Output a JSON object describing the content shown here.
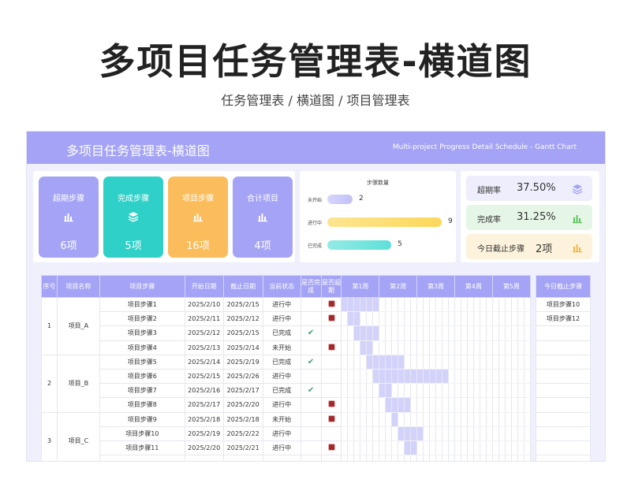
{
  "page": {
    "title": "多项目任务管理表-横道图",
    "subtitle": "任务管理表 / 横道图 / 项目管理表"
  },
  "banner": {
    "title": "多项目任务管理表-横道图",
    "subtitle_en": "Multi-project Progress Detail Schedule - Gantt Chart"
  },
  "kpis": [
    {
      "label": "超期步骤",
      "value": "6项",
      "color": "#a4a3f5",
      "icon": "bar-chart-icon"
    },
    {
      "label": "完成步骤",
      "value": "5项",
      "color": "#2ed0c7",
      "icon": "layers-icon"
    },
    {
      "label": "项目步骤",
      "value": "16项",
      "color": "#fbbd5b",
      "icon": "bar-chart-icon"
    },
    {
      "label": "合计项目",
      "value": "4项",
      "color": "#a4a3f5",
      "icon": "bar-chart-icon"
    }
  ],
  "step_chart": {
    "title": "步骤数量",
    "max": 9,
    "rows": [
      {
        "label": "未开始",
        "value": 2,
        "color": "#c2c1f9"
      },
      {
        "label": "进行中",
        "value": 9,
        "color": "#fcd85a"
      },
      {
        "label": "已完成",
        "value": 5,
        "color": "#5ee0d8"
      }
    ]
  },
  "rates": [
    {
      "label": "超期率",
      "value": "37.50%",
      "bg": "#eeeefc",
      "icon": "layers-icon",
      "icon_color": "#a4a3f5"
    },
    {
      "label": "完成率",
      "value": "31.25%",
      "bg": "#e6f6e6",
      "icon": "bar-chart-icon",
      "icon_color": "#5cc05c"
    },
    {
      "label": "今日截止步骤",
      "value": "2项",
      "bg": "#fdf3dc",
      "icon": "bar-chart-icon",
      "icon_color": "#f3b64a"
    }
  ],
  "table": {
    "headers": [
      "序号",
      "项目名称",
      "项目步骤",
      "开始日期",
      "截止日期",
      "当前状态",
      "是否完成",
      "是否超期"
    ],
    "weeks": [
      "第1周",
      "第2周",
      "第3周",
      "第4周",
      "第5周"
    ],
    "projects": [
      {
        "no": "1",
        "name": "项目_A",
        "steps": [
          {
            "step": "项目步骤1",
            "start": "2025/2/10",
            "end": "2025/2/15",
            "status": "进行中",
            "done": false,
            "overdue": true,
            "bar_from": 0,
            "bar_to": 5
          },
          {
            "step": "项目步骤2",
            "start": "2025/2/11",
            "end": "2025/2/12",
            "status": "进行中",
            "done": false,
            "overdue": true,
            "bar_from": 1,
            "bar_to": 2
          },
          {
            "step": "项目步骤3",
            "start": "2025/2/12",
            "end": "2025/2/15",
            "status": "已完成",
            "done": true,
            "overdue": false,
            "bar_from": 2,
            "bar_to": 5
          },
          {
            "step": "项目步骤4",
            "start": "2025/2/13",
            "end": "2025/2/14",
            "status": "未开始",
            "done": false,
            "overdue": true,
            "bar_from": 3,
            "bar_to": 4
          }
        ]
      },
      {
        "no": "2",
        "name": "项目_B",
        "steps": [
          {
            "step": "项目步骤5",
            "start": "2025/2/14",
            "end": "2025/2/19",
            "status": "已完成",
            "done": true,
            "overdue": false,
            "bar_from": 4,
            "bar_to": 9
          },
          {
            "step": "项目步骤6",
            "start": "2025/2/15",
            "end": "2025/2/26",
            "status": "进行中",
            "done": false,
            "overdue": false,
            "bar_from": 5,
            "bar_to": 16
          },
          {
            "step": "项目步骤7",
            "start": "2025/2/16",
            "end": "2025/2/17",
            "status": "已完成",
            "done": true,
            "overdue": false,
            "bar_from": 6,
            "bar_to": 7
          },
          {
            "step": "项目步骤8",
            "start": "2025/2/17",
            "end": "2025/2/20",
            "status": "进行中",
            "done": false,
            "overdue": true,
            "bar_from": 7,
            "bar_to": 10
          }
        ]
      },
      {
        "no": "3",
        "name": "项目_C",
        "steps": [
          {
            "step": "项目步骤9",
            "start": "2025/2/18",
            "end": "2025/2/18",
            "status": "未开始",
            "done": false,
            "overdue": true,
            "bar_from": 8,
            "bar_to": 8
          },
          {
            "step": "项目步骤10",
            "start": "2025/2/19",
            "end": "2025/2/22",
            "status": "进行中",
            "done": false,
            "overdue": false,
            "bar_from": 9,
            "bar_to": 12
          },
          {
            "step": "项目步骤11",
            "start": "2025/2/20",
            "end": "2025/2/21",
            "status": "进行中",
            "done": false,
            "overdue": true,
            "bar_from": 10,
            "bar_to": 11
          }
        ]
      }
    ]
  },
  "due_today": {
    "header": "今日截止步骤",
    "items": [
      "项目步骤10",
      "项目步骤12"
    ]
  }
}
